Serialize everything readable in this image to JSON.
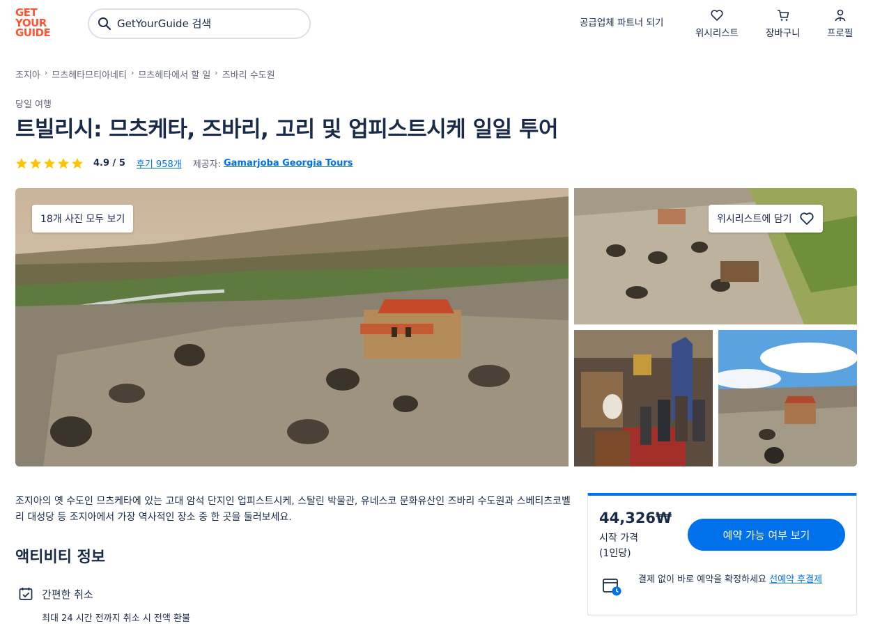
{
  "header": {
    "logo": [
      "GET",
      "YOUR",
      "GUIDE"
    ],
    "search_placeholder": "GetYourGuide 검색",
    "partner_link": "공급업체 파트너 되기",
    "wishlist": "위시리스트",
    "cart": "장바구니",
    "profile": "프로필"
  },
  "breadcrumb": [
    "조지아",
    "므츠헤타므티아네티",
    "므츠헤타에서 할 일",
    "즈바리 수도원"
  ],
  "activity": {
    "category": "당일 여행",
    "title": "트빌리시: 므츠케타, 즈바리, 고리 및 업피스트시케 일일 투어",
    "rating_value": 5,
    "score": "4.9 / 5",
    "reviews": "후기 958개",
    "provider_label": "제공자:",
    "provider": "Gamarjoba Georgia Tours"
  },
  "gallery": {
    "all_photos": "18개 사진 모두 보기",
    "add_wishlist": "위시리스트에 담기"
  },
  "description": "조지아의 옛 수도인 므츠케타에 있는 고대 암석 단지인 업피스트시케, 스탈린 박물관, 유네스코 문화유산인 즈바리 수도원과 스베티츠코벨리 대성당 등 조지아에서 가장 역사적인 장소 중 한 곳을 둘러보세요.",
  "info": {
    "heading": "액티비티 정보",
    "cancel_title": "간편한 취소",
    "cancel_sub": "최대 24 시간 전까지 취소 시 전액 환불"
  },
  "booking": {
    "price": "44,326₩",
    "from": "시작 가격",
    "per": "(1인당)",
    "check_button": "예약 가능 여부 보기",
    "reserve_text": "결제 없이 바로 예약을 확정하세요 ",
    "reserve_link": "선예약 후결제"
  },
  "colors": {
    "brand": "#ff5533",
    "primary": "#0071eb",
    "text": "#1a2b49",
    "star": "#fdc500"
  }
}
